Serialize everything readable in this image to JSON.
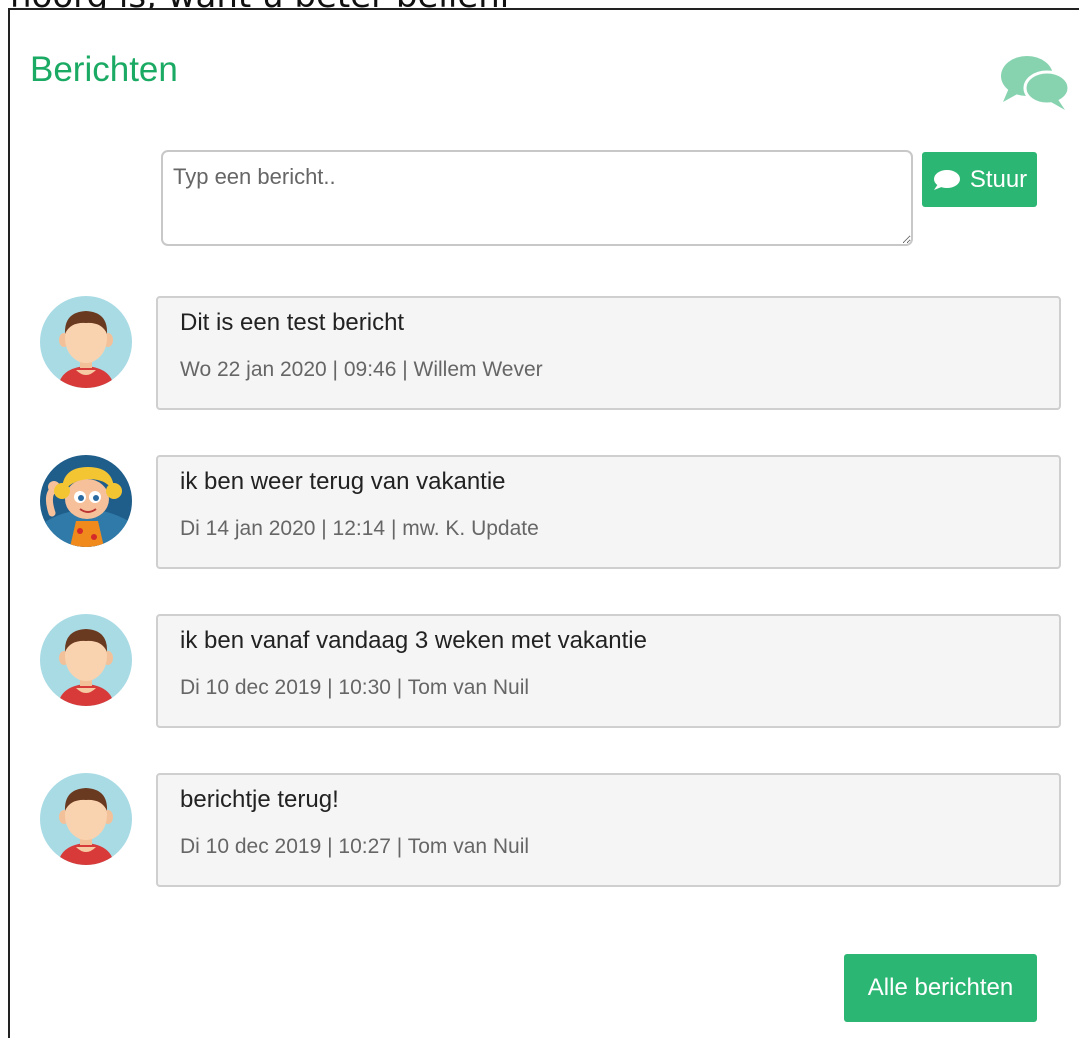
{
  "page": {
    "caption": "hoorg is, want u beter belleni"
  },
  "panel": {
    "title": "Berichten",
    "header_icon": "chat-bubbles-icon",
    "accent_color": "#1aaa63",
    "button_color": "#2cb673"
  },
  "compose": {
    "placeholder": "Typ een bericht..",
    "value": "",
    "send_label": "Stuur",
    "send_icon": "speech-bubble-icon"
  },
  "messages": [
    {
      "text": "Dit is een test bericht",
      "meta": "Wo 22 jan 2020 | 09:46 | Willem Wever",
      "avatar": "boy-avatar"
    },
    {
      "text": "ik ben weer terug van vakantie",
      "meta": "Di 14 jan 2020 | 12:14 | mw. K. Update",
      "avatar": "cartoon-girl-avatar"
    },
    {
      "text": "ik ben vanaf vandaag 3 weken met vakantie",
      "meta": "Di 10 dec 2019 | 10:30 | Tom van Nuil",
      "avatar": "boy-avatar"
    },
    {
      "text": "berichtje terug!",
      "meta": "Di 10 dec 2019 | 10:27 | Tom van Nuil",
      "avatar": "boy-avatar"
    }
  ],
  "footer": {
    "all_messages_label": "Alle berichten"
  }
}
